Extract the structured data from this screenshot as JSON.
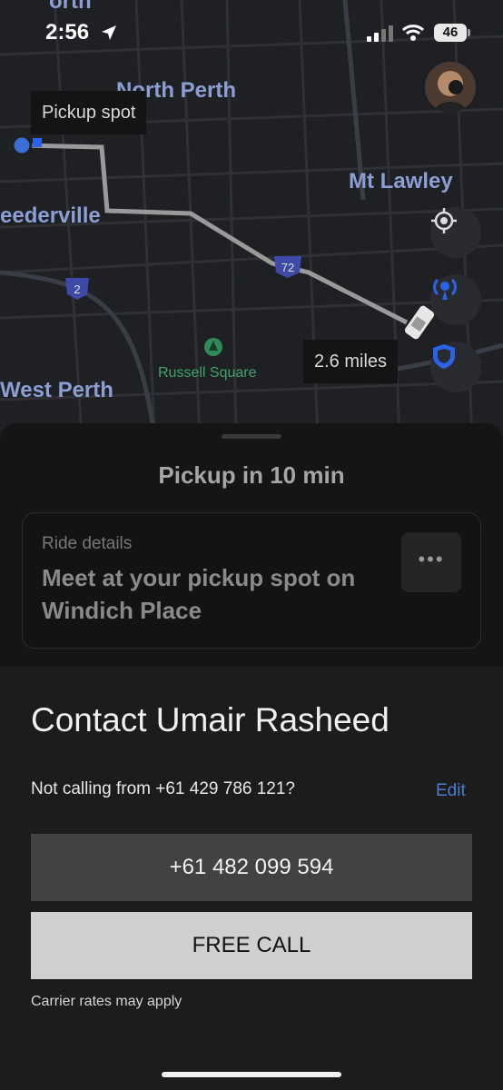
{
  "status": {
    "time": "2:56",
    "battery": "46"
  },
  "map": {
    "labels": {
      "north_perth": "North Perth",
      "mt_lawley": "Mt Lawley",
      "leederville": "eederville",
      "west_perth": "West Perth",
      "russell_square": "Russell Square",
      "top_cut": "orth"
    },
    "route_shields": [
      "72",
      "2"
    ],
    "pickup_pill": "Pickup spot",
    "distance_pill": "2.6 miles",
    "icons": [
      "location-arrow-icon",
      "recenter-icon",
      "broadcast-icon",
      "shield-icon",
      "car-icon",
      "tree-icon"
    ]
  },
  "sheet": {
    "pickup_title": "Pickup in 10 min",
    "ride_details_label": "Ride details",
    "ride_details_text": "Meet at your pickup spot on Windich Place",
    "more_label": "•••"
  },
  "contact": {
    "title": "Contact Umair Rasheed",
    "not_calling": "Not calling from +61 429 786 121?",
    "edit": "Edit",
    "phone_number": "+61 482 099 594",
    "free_call": "FREE CALL",
    "carrier_note": "Carrier rates may apply"
  },
  "colors": {
    "map_bg": "#1f2024",
    "route": "#9a9a9a",
    "accent_blue": "#2a63e8",
    "link": "#4a7fd0"
  }
}
